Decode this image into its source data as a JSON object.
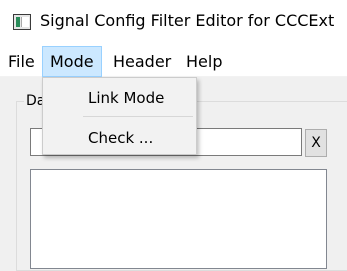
{
  "window": {
    "title": "Signal Config Filter Editor for CCCExt",
    "icon": "app-window-icon"
  },
  "menubar": {
    "file": "File",
    "mode": "Mode",
    "header": "Header",
    "help": "Help"
  },
  "mode_menu": {
    "items": [
      {
        "label": "Link Mode"
      },
      {
        "label": "Check ..."
      }
    ]
  },
  "group": {
    "legend": "Da"
  },
  "filter": {
    "value": "",
    "clear_label": "X"
  },
  "colors": {
    "menu_highlight": "#cce8ff",
    "menu_highlight_border": "#99d1ff",
    "window_bg": "#f0f0f0"
  }
}
